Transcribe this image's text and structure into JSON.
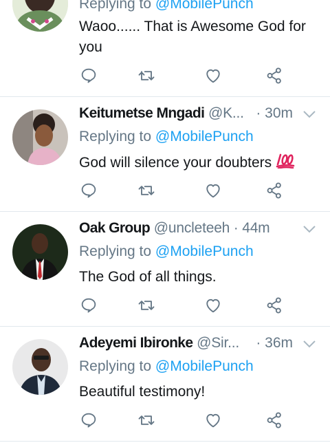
{
  "tweets": [
    {
      "name": "",
      "handle": "",
      "time": "",
      "replying_label": "Replying to",
      "replying_mention": "@MobilePunch",
      "text": "Waoo...... That is Awesome God for you",
      "emoji": ""
    },
    {
      "name": "Keitumetse Mngadi",
      "handle": "@K...",
      "time": "· 30m",
      "replying_label": "Replying to",
      "replying_mention": "@MobilePunch",
      "text": "God will silence your doubters",
      "emoji": "100-emoji"
    },
    {
      "name": "Oak Group",
      "handle": "@uncleteeh · 44m",
      "time": "",
      "replying_label": "Replying to",
      "replying_mention": "@MobilePunch",
      "text": "The God of all things.",
      "emoji": ""
    },
    {
      "name": "Adeyemi Ibironke",
      "handle": "@Sir...",
      "time": "· 36m",
      "replying_label": "Replying to",
      "replying_mention": "@MobilePunch",
      "text": "Beautiful testimony!",
      "emoji": ""
    }
  ],
  "icons": {
    "reply": "reply-icon",
    "retweet": "retweet-icon",
    "like": "heart-icon",
    "share": "share-icon",
    "more": "chevron-down-icon"
  },
  "colors": {
    "link": "#1da1f2",
    "secondary": "#657786",
    "icon": "#657786",
    "divider": "#e1e8ed"
  }
}
